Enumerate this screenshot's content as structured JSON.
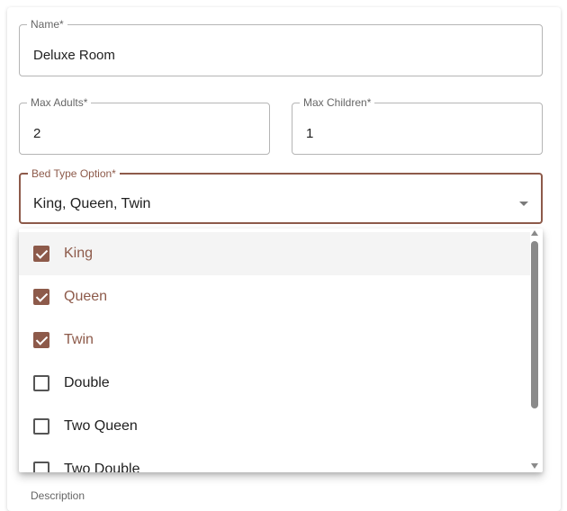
{
  "form": {
    "name": {
      "label": "Name*",
      "value": "Deluxe Room"
    },
    "max_adults": {
      "label": "Max Adults*",
      "value": "2"
    },
    "max_children": {
      "label": "Max Children*",
      "value": "1"
    },
    "bed_type": {
      "label": "Bed Type Option*",
      "value": "King, Queen, Twin"
    },
    "next_label": "Description"
  },
  "bed_menu": {
    "options": [
      {
        "label": "King",
        "checked": true
      },
      {
        "label": "Queen",
        "checked": true
      },
      {
        "label": "Twin",
        "checked": true
      },
      {
        "label": "Double",
        "checked": false
      },
      {
        "label": "Two Queen",
        "checked": false
      },
      {
        "label": "Two Double",
        "checked": false
      }
    ]
  },
  "colors": {
    "accent": "#8d5a4a",
    "hover": "#f4f4f4",
    "border": "#b5b5b5"
  }
}
